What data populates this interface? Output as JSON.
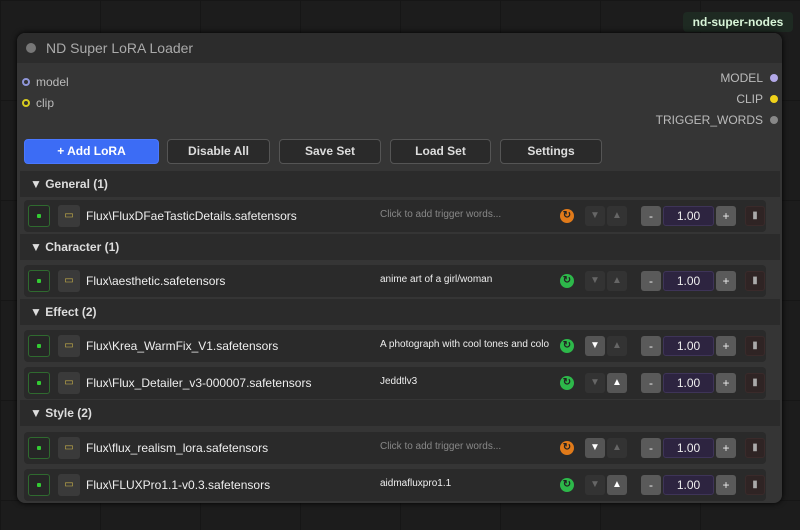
{
  "badge": "nd-super-nodes",
  "node": {
    "title": "ND Super LoRA Loader",
    "inputs": [
      {
        "label": "model",
        "color": "#8f96d8"
      },
      {
        "label": "clip",
        "color": "#d8cc20"
      }
    ],
    "outputs": [
      {
        "label": "MODEL",
        "color": "#b3a9e8"
      },
      {
        "label": "CLIP",
        "color": "#f0d21a"
      },
      {
        "label": "TRIGGER_WORDS",
        "color": "#888"
      }
    ]
  },
  "toolbar": {
    "add": "+ Add LoRA",
    "disable_all": "Disable All",
    "save_set": "Save Set",
    "load_set": "Load Set",
    "settings": "Settings"
  },
  "groups": [
    {
      "label": "▼  General (1)"
    },
    {
      "label": "▼  Character (1)"
    },
    {
      "label": "▼  Effect (2)"
    },
    {
      "label": "▼  Style (2)"
    }
  ],
  "loras": [
    {
      "name": "Flux\\FluxDFaeTasticDetails.safetensors",
      "trigger": "Click to add trigger words...",
      "placeholder": true,
      "refresh": "#e07a1a",
      "down": false,
      "up": false,
      "strength": "1.00"
    },
    {
      "name": "Flux\\aesthetic.safetensors",
      "trigger": "anime art of a girl/woman",
      "placeholder": false,
      "refresh": "#2db84a",
      "down": false,
      "up": false,
      "strength": "1.00"
    },
    {
      "name": "Flux\\Krea_WarmFix_V1.safetensors",
      "trigger": "A photograph with cool tones and colo",
      "placeholder": false,
      "refresh": "#2db84a",
      "down": true,
      "up": false,
      "strength": "1.00"
    },
    {
      "name": "Flux\\Flux_Detailer_v3-000007.safetensors",
      "trigger": "Jeddtlv3",
      "placeholder": false,
      "refresh": "#2db84a",
      "down": false,
      "up": true,
      "strength": "1.00"
    },
    {
      "name": "Flux\\flux_realism_lora.safetensors",
      "trigger": "Click to add trigger words...",
      "placeholder": true,
      "refresh": "#e07a1a",
      "down": true,
      "up": false,
      "strength": "1.00"
    },
    {
      "name": "Flux\\FLUXPro1.1-v0.3.safetensors",
      "trigger": "aidmafluxpro1.1",
      "placeholder": false,
      "refresh": "#2db84a",
      "down": false,
      "up": true,
      "strength": "1.00"
    }
  ]
}
